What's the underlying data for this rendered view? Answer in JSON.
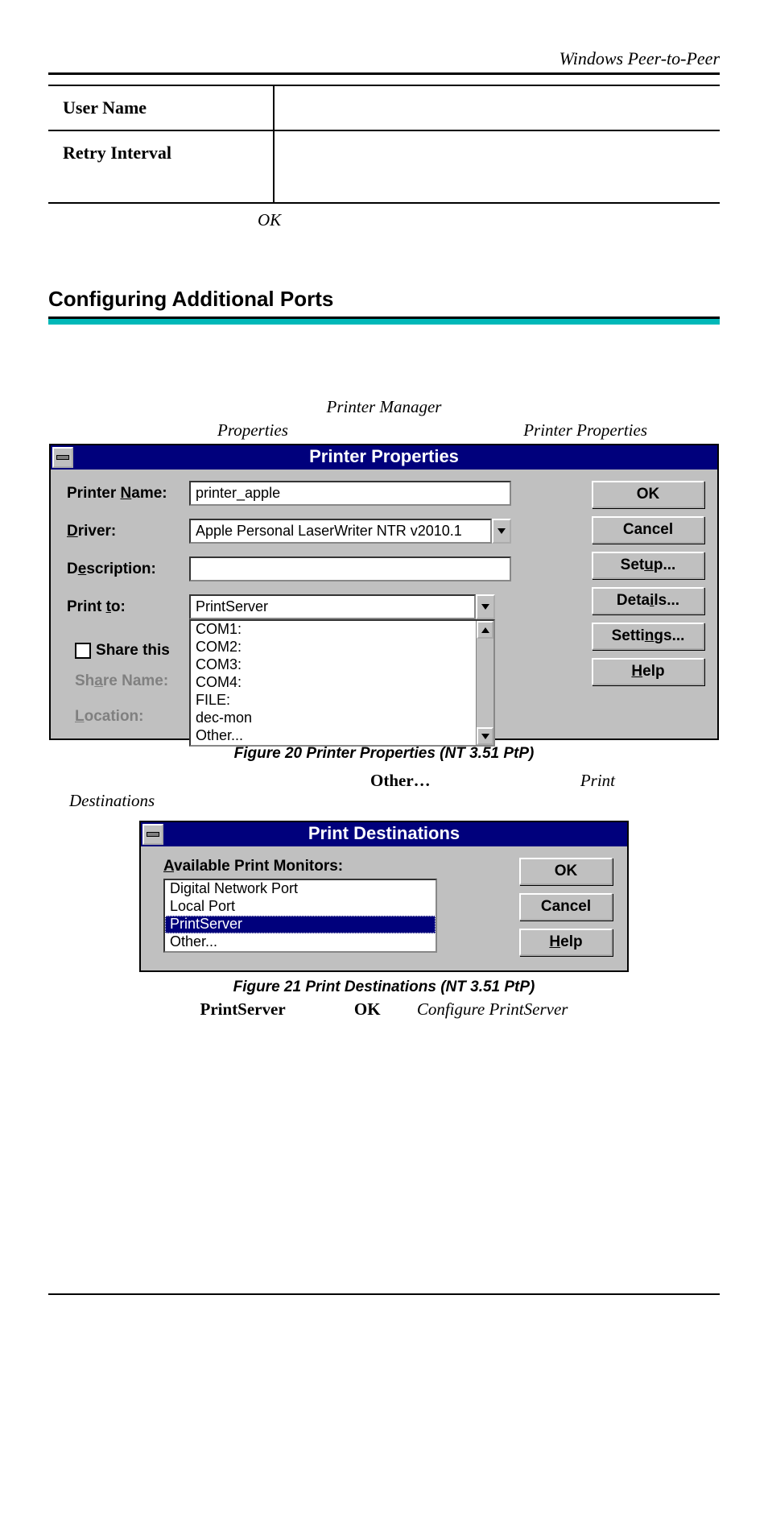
{
  "header": {
    "title": "Windows Peer-to-Peer"
  },
  "infoTable": {
    "rows": [
      {
        "label": "User Name",
        "value": ""
      },
      {
        "label": "Retry Interval",
        "value": ""
      }
    ]
  },
  "okWord": "OK",
  "sectionHeading": "Configuring Additional Ports",
  "preDialogLine1": {
    "left": "Printer Manager"
  },
  "preDialogLine2": {
    "left": "Properties",
    "right": "Printer Properties"
  },
  "dialog1": {
    "title": "Printer Properties",
    "fields": {
      "printerName": {
        "label_pre": "Printer ",
        "label_ul": "N",
        "label_post": "ame:",
        "value": "printer_apple"
      },
      "driver": {
        "label_ul": "D",
        "label_post": "river:",
        "value": "Apple Personal LaserWriter NTR v2010.1"
      },
      "description": {
        "label_pre": "D",
        "label_ul": "e",
        "label_post": "scription:",
        "value": ""
      },
      "printTo": {
        "label_pre": "Print ",
        "label_ul": "t",
        "label_post": "o:",
        "value": "PrintServer"
      }
    },
    "listItems": [
      "COM1:",
      "COM2:",
      "COM3:",
      "COM4:",
      "FILE:",
      "dec-mon",
      "Other..."
    ],
    "shareCheckbox": {
      "label_ul": "S",
      "label_post": "hare this"
    },
    "shareName": {
      "label_pre": "Sh",
      "label_ul": "a",
      "label_post": "re Name:"
    },
    "location": {
      "label_ul": "L",
      "label_post": "ocation:"
    },
    "buttons": {
      "ok": "OK",
      "cancel": "Cancel",
      "setup": {
        "pre": "Set",
        "ul": "u",
        "post": "p..."
      },
      "details": {
        "pre": "Deta",
        "ul": "i",
        "post": "ls..."
      },
      "settings": {
        "pre": "Setti",
        "ul": "n",
        "post": "gs..."
      },
      "help": {
        "ul": "H",
        "post": "elp"
      }
    }
  },
  "figure1Caption": "Figure 20 Printer Properties (NT 3.51 PtP)",
  "afterFig1": {
    "bold": "Other…",
    "italic": "Print",
    "hang": "Destinations"
  },
  "dialog2": {
    "title": "Print Destinations",
    "label": {
      "ul": "A",
      "post": "vailable Print Monitors:"
    },
    "items": [
      "Digital Network Port",
      "Local Port",
      "PrintServer",
      "Other..."
    ],
    "selectedIndex": 2,
    "buttons": {
      "ok": "OK",
      "cancel": "Cancel",
      "help": {
        "ul": "H",
        "post": "elp"
      }
    }
  },
  "figure2Caption": "Figure 21 Print Destinations (NT 3.51 PtP)",
  "finalLine": {
    "b1": "PrintServer",
    "b2": "OK",
    "italic": "Configure PrintServer"
  }
}
